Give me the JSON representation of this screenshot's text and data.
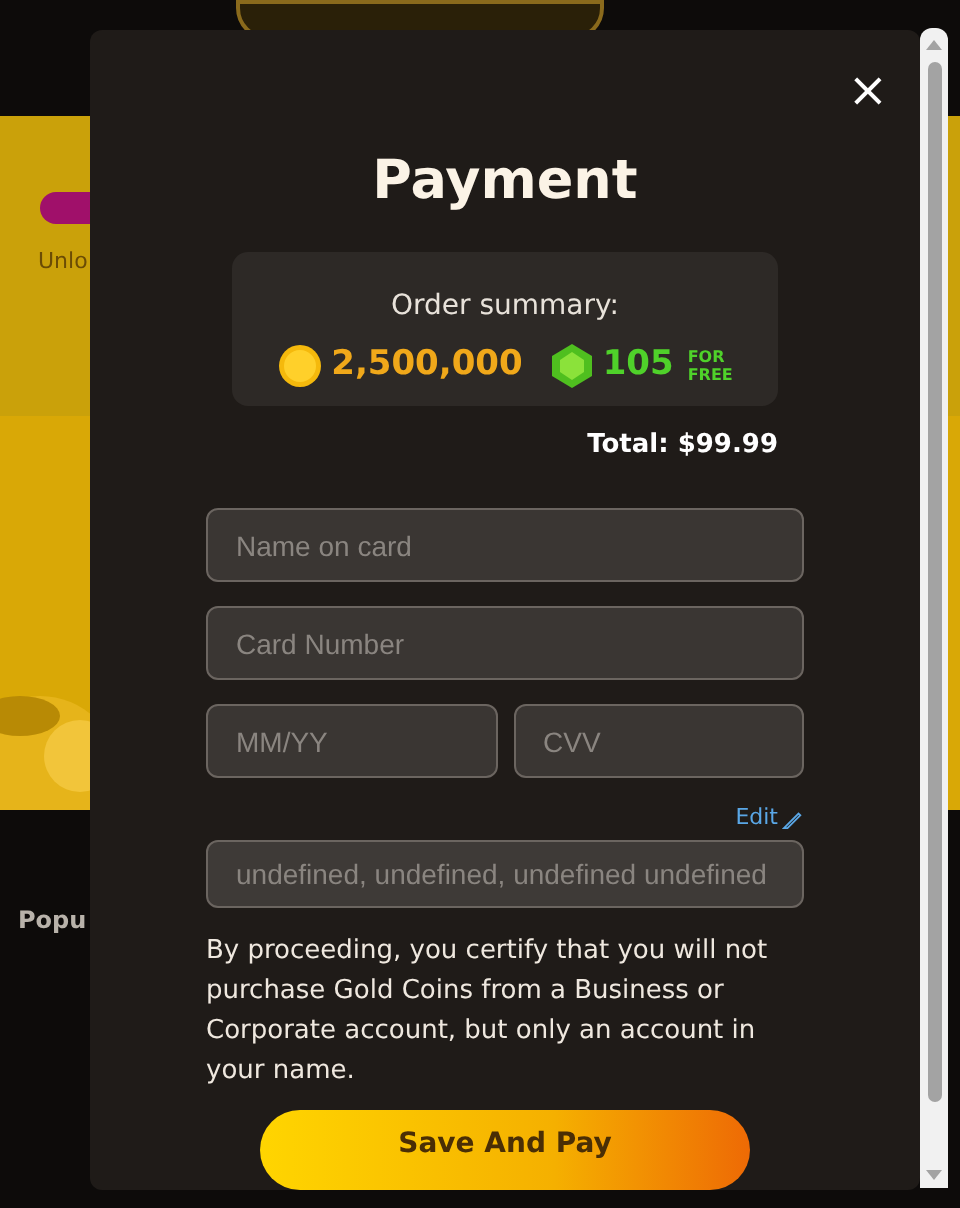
{
  "background": {
    "banner_text": "Unlo",
    "section_title": "Popu"
  },
  "dialog": {
    "title": "Payment",
    "close": "×",
    "order_summary": {
      "heading": "Order summary:",
      "coins": "2,500,000",
      "gems": "105",
      "bonus_top": "FOR",
      "bonus_bottom": "FREE"
    },
    "total": "Total: $99.99",
    "field_rows": [
      [
        {
          "placeholder": "Name on card"
        }
      ],
      [
        {
          "placeholder": "Card Number"
        }
      ],
      [
        {
          "placeholder": "MM/YY"
        },
        {
          "placeholder": "CVV"
        }
      ]
    ],
    "edit_link": "Edit",
    "address": {
      "value": "undefined, undefined, undefined undefined",
      "disabled": true
    },
    "disclaimer": "By proceeding, you certify that you will not purchase Gold Coins from a Business or Corporate account, but only an account in your name.",
    "submit": "Save And Pay"
  }
}
